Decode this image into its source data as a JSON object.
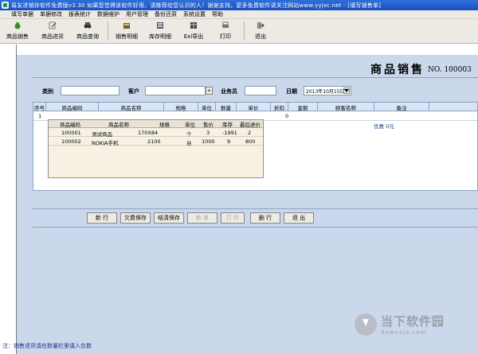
{
  "window": {
    "title": "易友进销存软件免费版v3.30    如果您觉得该软件好用，请推荐给您认识的人！谢谢支持。更多免费软件请关注网站www.yyjxc.net - [填写销售单]"
  },
  "menu": [
    "填写单据",
    "单据修改",
    "报表统计",
    "数据维护",
    "用户管理",
    "备份还原",
    "系统设置",
    "帮助"
  ],
  "toolbar": {
    "items": [
      {
        "label": "商品销售",
        "icon": "money-bag-icon"
      },
      {
        "label": "商品进货",
        "icon": "document-edit-icon"
      },
      {
        "label": "商品查询",
        "icon": "binoculars-icon"
      },
      {
        "label": "销售明细",
        "icon": "sales-detail-icon"
      },
      {
        "label": "库存明细",
        "icon": "inventory-icon"
      },
      {
        "label": "Exl导出",
        "icon": "excel-export-icon"
      },
      {
        "label": "打印",
        "icon": "printer-icon"
      },
      {
        "label": "退出",
        "icon": "exit-icon"
      }
    ]
  },
  "form": {
    "heading": "商品销售",
    "order_no": "NO. 100003",
    "category_label": "类别",
    "category_value": "",
    "customer_label": "客户",
    "customer_value": "",
    "customer_button": "+",
    "salesman_label": "业务员",
    "salesman_value": "",
    "date_label": "日期",
    "date_value": "2013年10月15日"
  },
  "grid": {
    "columns": [
      "序号",
      "商品编码",
      "商品名称",
      "规格",
      "单位",
      "数量",
      "单价",
      "折扣",
      "金额",
      "顾客名称",
      "备注"
    ],
    "row": {
      "index": "1",
      "discount": "0",
      "remark": "优惠 0元"
    }
  },
  "popup": {
    "columns": [
      "商品编码",
      "商品名称",
      "规格",
      "单位",
      "售价",
      "库存",
      "最后进价"
    ],
    "rows": [
      {
        "code": "100001",
        "name": "测试商品",
        "spec": "170X84",
        "unit": "个",
        "price": "3",
        "stock": "-1991",
        "last_cost": "2"
      },
      {
        "code": "100002",
        "name": "NOKIA手机",
        "spec": "2100",
        "unit": "台",
        "price": "1000",
        "stock": "9",
        "last_cost": "800"
      }
    ]
  },
  "buttons": {
    "new": "新 行",
    "credit_save": "欠费保存",
    "settle_save": "结清保存",
    "new_doc": "新 单",
    "print": "打 印",
    "delete_row": "删 行",
    "exit": "退 出"
  },
  "footer_note": "注：销售退货请在数量栏里填入负数",
  "watermark": {
    "main": "当下软件园",
    "sub": "downxia.com"
  },
  "colors": {
    "panel": "#cbd7ea",
    "titlebar": "#1a4fbf",
    "note": "#1a3a8a"
  }
}
